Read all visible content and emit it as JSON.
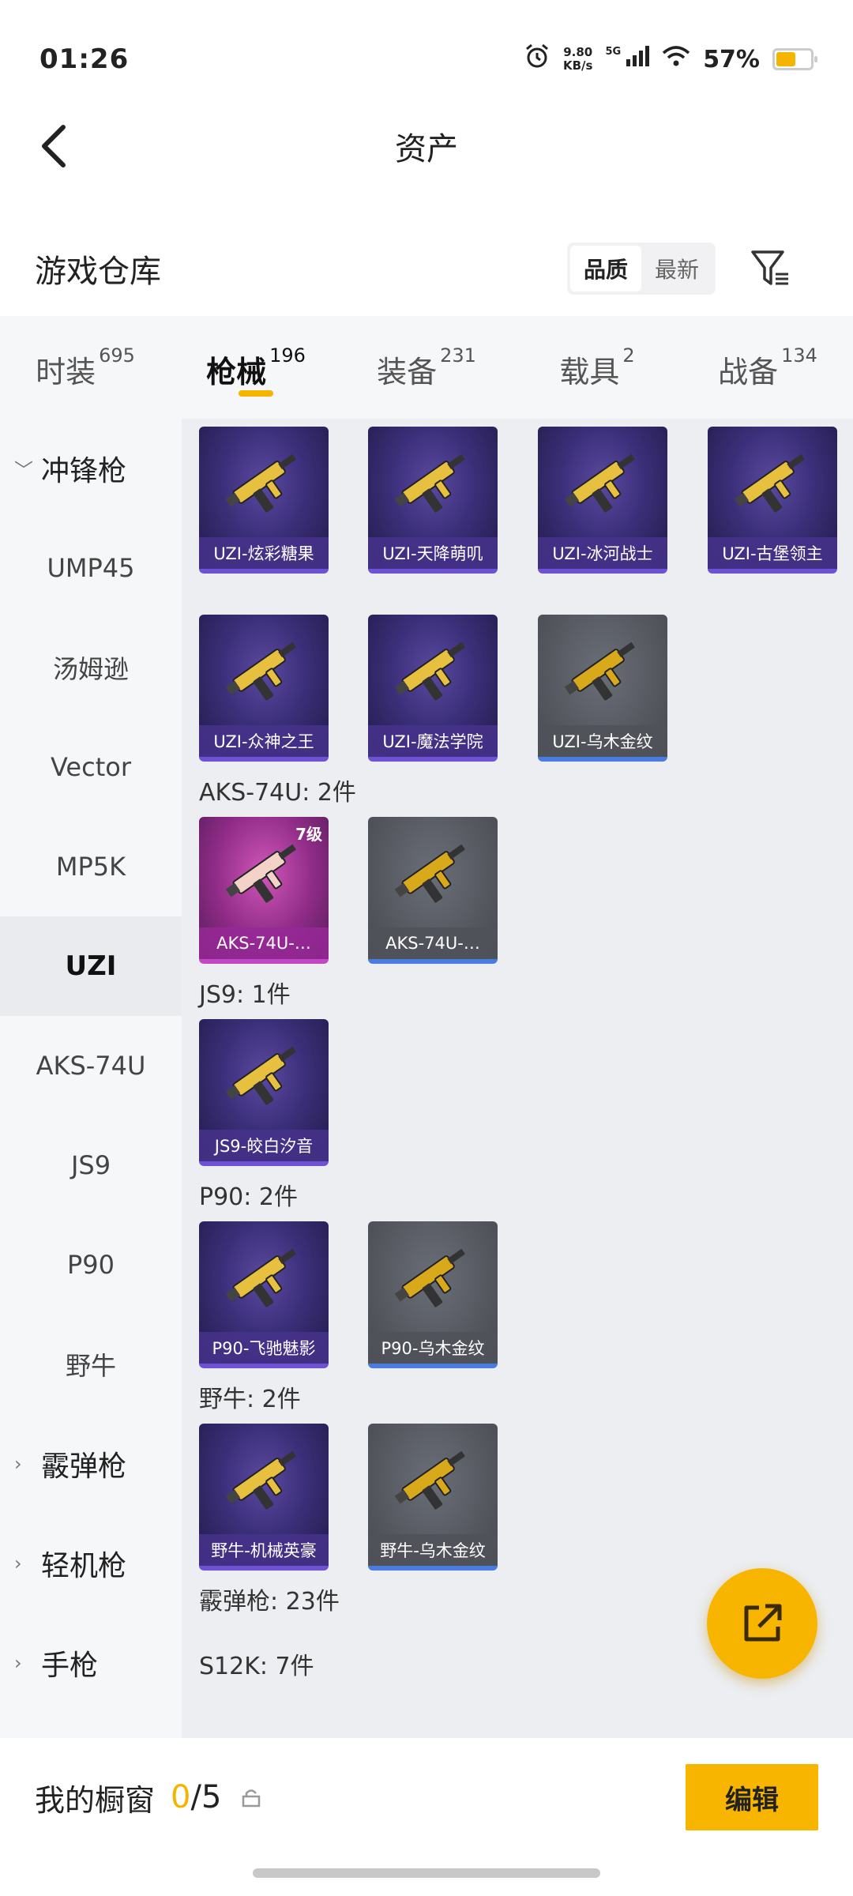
{
  "status_bar": {
    "time": "01:26",
    "net_speed_value": "9.80",
    "net_speed_unit": "KB/s",
    "network": "5G",
    "battery_percent": "57%",
    "battery_level": 0.57
  },
  "header": {
    "title": "资产"
  },
  "warehouse": {
    "title": "游戏仓库",
    "sort_options": [
      "品质",
      "最新"
    ],
    "active_sort": "品质"
  },
  "category_tabs": [
    {
      "label": "时装",
      "count": "695"
    },
    {
      "label": "枪械",
      "count": "196"
    },
    {
      "label": "装备",
      "count": "231"
    },
    {
      "label": "载具",
      "count": "2"
    },
    {
      "label": "战备",
      "count": "134"
    }
  ],
  "sidebar": {
    "items": [
      {
        "label": "冲锋枪",
        "type": "group",
        "chevron": "﹀"
      },
      {
        "label": "UMP45",
        "type": "item"
      },
      {
        "label": "汤姆逊",
        "type": "item"
      },
      {
        "label": "Vector",
        "type": "item"
      },
      {
        "label": "MP5K",
        "type": "item"
      },
      {
        "label": "UZI",
        "type": "item",
        "active": true
      },
      {
        "label": "AKS-74U",
        "type": "item"
      },
      {
        "label": "JS9",
        "type": "item"
      },
      {
        "label": "P90",
        "type": "item"
      },
      {
        "label": "野牛",
        "type": "item"
      },
      {
        "label": "霰弹枪",
        "type": "group",
        "chevron": "›"
      },
      {
        "label": "轻机枪",
        "type": "group",
        "chevron": "›"
      },
      {
        "label": "手枪",
        "type": "group",
        "chevron": "›"
      }
    ]
  },
  "content": {
    "uzi_cards": [
      {
        "label": "UZI-炫彩糖果",
        "rarity": "purple"
      },
      {
        "label": "UZI-天降萌叽",
        "rarity": "purple"
      },
      {
        "label": "UZI-冰河战士",
        "rarity": "purple"
      },
      {
        "label": "UZI-古堡领主",
        "rarity": "purple"
      },
      {
        "label": "UZI-众神之王",
        "rarity": "purple"
      },
      {
        "label": "UZI-魔法学院",
        "rarity": "purple"
      },
      {
        "label": "UZI-乌木金纹",
        "rarity": "gray"
      }
    ],
    "sections": [
      {
        "title": "AKS-74U: 2件",
        "cards": [
          {
            "label": "AKS-74U-…",
            "rarity": "pink",
            "level": "7级"
          },
          {
            "label": "AKS-74U-…",
            "rarity": "gray"
          }
        ]
      },
      {
        "title": "JS9: 1件",
        "cards": [
          {
            "label": "JS9-皎白汐音",
            "rarity": "purple"
          }
        ]
      },
      {
        "title": "P90: 2件",
        "cards": [
          {
            "label": "P90-飞驰魅影",
            "rarity": "purple"
          },
          {
            "label": "P90-乌木金纹",
            "rarity": "gray"
          }
        ]
      },
      {
        "title": "野牛: 2件",
        "cards": [
          {
            "label": "野牛-机械英豪",
            "rarity": "purple"
          },
          {
            "label": "野牛-乌木金纹",
            "rarity": "gray"
          }
        ]
      }
    ],
    "footer_titles": [
      "霰弹枪: 23件",
      "S12K: 7件"
    ]
  },
  "bottom_bar": {
    "title": "我的橱窗",
    "current": "0",
    "separator": "/",
    "total": "5",
    "edit_label": "编辑"
  },
  "colors": {
    "accent": "#f5b400",
    "purple_card": "#3c2f7a",
    "gray_card": "#55585f",
    "pink_card": "#8e2b86"
  }
}
